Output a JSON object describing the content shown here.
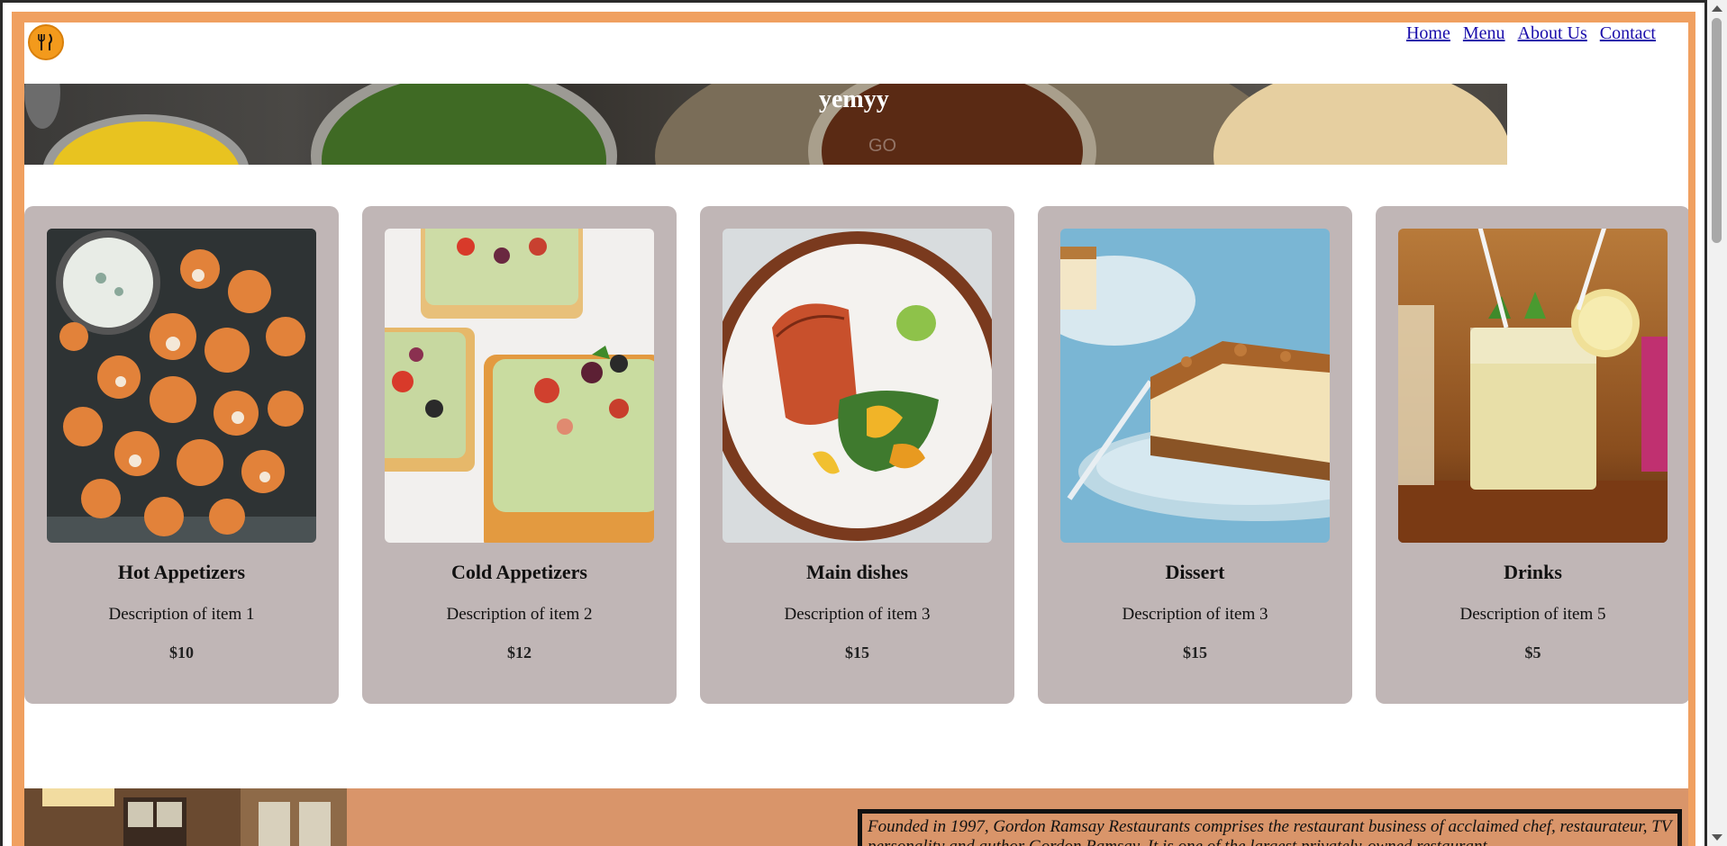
{
  "nav": {
    "logo_icon": "restaurant-utensils-icon",
    "items": [
      {
        "label": "Home"
      },
      {
        "label": "Menu"
      },
      {
        "label": "About Us"
      },
      {
        "label": "Contact"
      }
    ]
  },
  "hero": {
    "title": "yemyy",
    "subtitle": "GO"
  },
  "menu": {
    "cards": [
      {
        "name": "Hot Appetizers",
        "description": "Description of item 1",
        "price": "$10",
        "image": "roasted-cauliflower-dip"
      },
      {
        "name": "Cold Appetizers",
        "description": "Description of item 2",
        "price": "$12",
        "image": "avocado-toast-bites"
      },
      {
        "name": "Main dishes",
        "description": "Description of item 3",
        "price": "$15",
        "image": "salmon-plate"
      },
      {
        "name": "Dissert",
        "description": "Description of item 3",
        "price": "$15",
        "image": "cheesecake-slice"
      },
      {
        "name": "Drinks",
        "description": "Description of item 5",
        "price": "$5",
        "image": "cocktail-glasses"
      }
    ]
  },
  "about": {
    "text": "Founded in 1997, Gordon Ramsay Restaurants comprises the restaurant business of acclaimed chef, restaurateur, TV personality and author Gordon Ramsay. It is one of the largest privately-owned restaurant"
  },
  "colors": {
    "frame": "#f0a060",
    "card_bg": "#c0b6b6",
    "about_bg": "#d9956a",
    "link": "#1a0dab"
  }
}
